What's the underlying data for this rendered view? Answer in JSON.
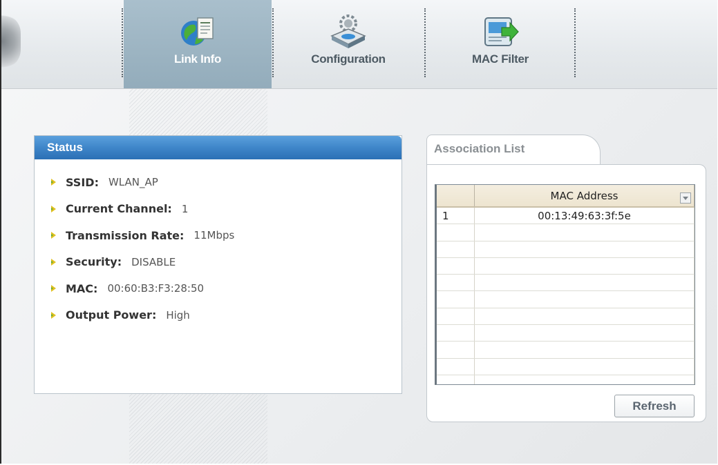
{
  "nav": {
    "tabs": [
      {
        "label": "Link Info",
        "icon": "globe-document-icon",
        "active": true
      },
      {
        "label": "Configuration",
        "icon": "router-gear-icon",
        "active": false
      },
      {
        "label": "MAC Filter",
        "icon": "filter-arrow-icon",
        "active": false
      }
    ]
  },
  "status": {
    "title": "Status",
    "items": [
      {
        "label": "SSID:",
        "value": "WLAN_AP"
      },
      {
        "label": "Current Channel:",
        "value": "1"
      },
      {
        "label": "Transmission Rate:",
        "value": "11Mbps"
      },
      {
        "label": "Security:",
        "value": "DISABLE"
      },
      {
        "label": "MAC:",
        "value": "00:60:B3:F3:28:50"
      },
      {
        "label": "Output Power:",
        "value": "High"
      }
    ]
  },
  "association": {
    "tab_label": "Association List",
    "columns": [
      "",
      "MAC Address"
    ],
    "rows": [
      {
        "index": "1",
        "mac": "00:13:49:63:3f:5e"
      }
    ],
    "refresh_label": "Refresh"
  },
  "colors": {
    "status_header": "#3f86c9",
    "active_tab": "#9fb6c4",
    "bullet": "#e0c020"
  }
}
